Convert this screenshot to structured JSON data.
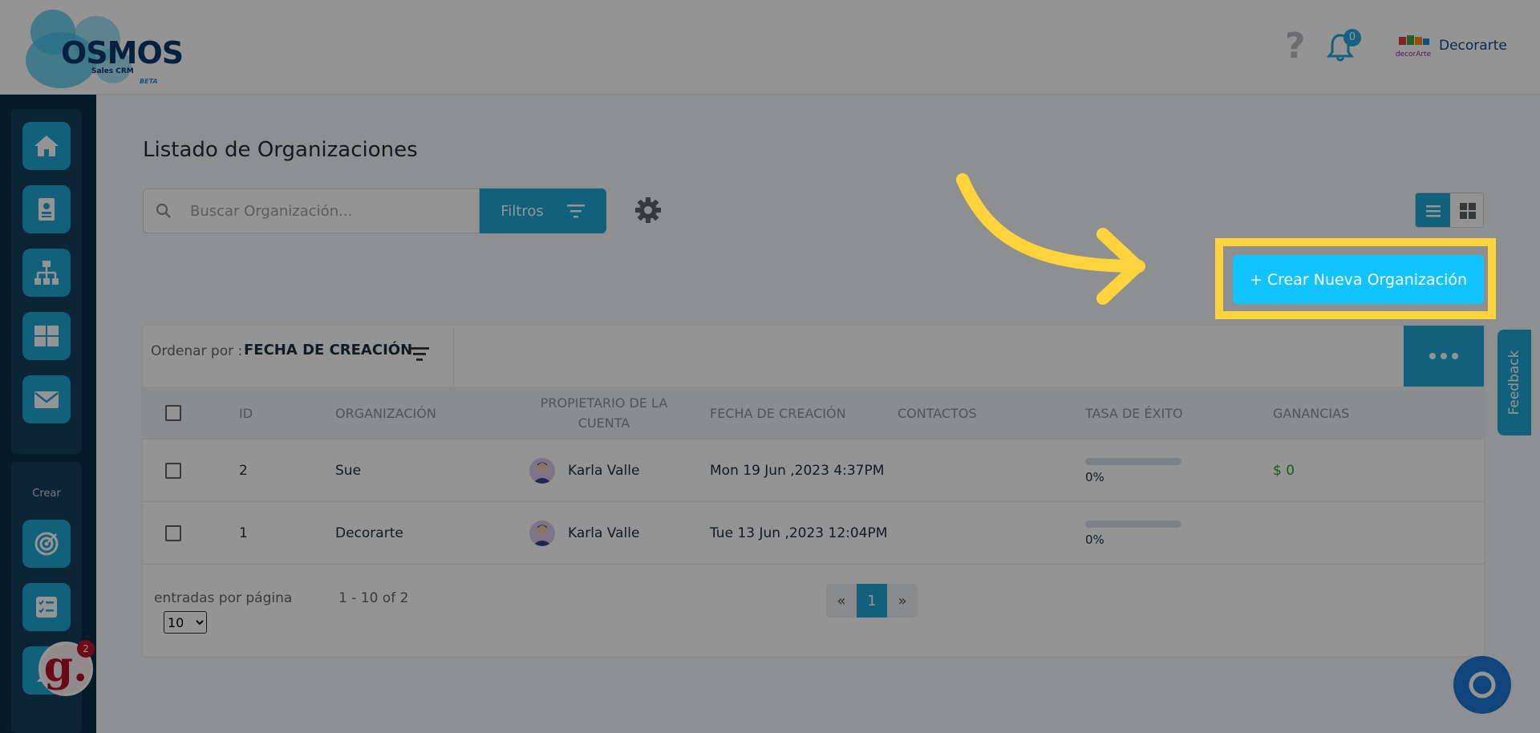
{
  "header": {
    "logo_word": "OSMOS",
    "logo_sub": "Sales CRM",
    "logo_beta": "BETA",
    "help_icon": "question-icon",
    "notifications_count": "0",
    "org_name": "Decorarte"
  },
  "sidebar": {
    "items": [
      {
        "icon": "home-icon"
      },
      {
        "icon": "contact-card-icon"
      },
      {
        "icon": "org-chart-icon"
      },
      {
        "icon": "grid-icon"
      },
      {
        "icon": "mail-icon"
      }
    ],
    "crear_label": "Crear",
    "create_items": [
      {
        "icon": "target-icon"
      },
      {
        "icon": "task-list-icon"
      }
    ]
  },
  "main": {
    "title": "Listado de Organizaciones",
    "search_placeholder": "Buscar Organización...",
    "filters_label": "Filtros",
    "create_button": "+ Crear Nueva Organización"
  },
  "table": {
    "sort_label": "Ordenar por :",
    "sort_value": "FECHA DE CREACIÓN",
    "columns": {
      "id": "ID",
      "org": "ORGANIZACIÓN",
      "owner": "PROPIETARIO DE LA CUENTA",
      "date": "FECHA DE CREACIÓN",
      "contacts": "CONTACTOS",
      "rate": "TASA DE ÉXITO",
      "earnings": "GANANCIAS"
    },
    "rows": [
      {
        "id": "2",
        "org": "Sue",
        "owner": "Karla Valle",
        "date": "Mon 19 Jun ,2023 4:37PM",
        "rate": "0%",
        "earnings": "$ 0"
      },
      {
        "id": "1",
        "org": "Decorarte",
        "owner": "Karla Valle",
        "date": "Tue 13 Jun ,2023 12:04PM",
        "rate": "0%",
        "earnings": ""
      }
    ],
    "per_page_label": "entradas por página",
    "per_page_value": "10",
    "range_text": "1 - 10 of 2",
    "pager": {
      "prev": "«",
      "current": "1",
      "next": "»"
    }
  },
  "feedback_label": "Feedback",
  "g_badge": {
    "letter": "g.",
    "count": "2"
  },
  "colors": {
    "accent": "#1ea6d6",
    "highlight": "#ffd33c",
    "create_button": "#11c4ff",
    "sidebar": "#0b2f49"
  }
}
